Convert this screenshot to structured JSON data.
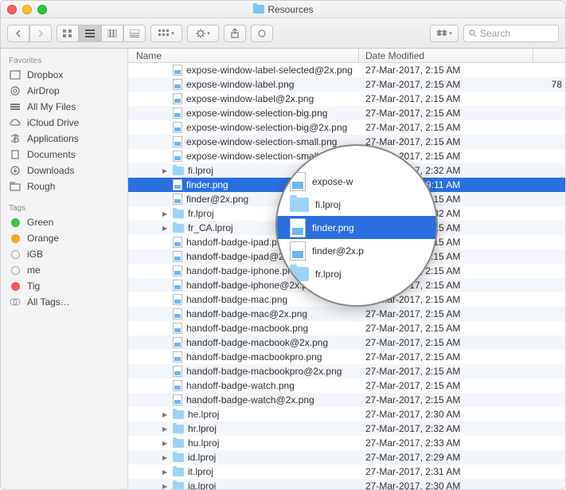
{
  "window": {
    "title": "Resources"
  },
  "toolbar": {
    "search_placeholder": "Search"
  },
  "columns": {
    "name": "Name",
    "date": "Date Modified"
  },
  "sidebar": {
    "favorites_label": "Favorites",
    "tags_label": "Tags",
    "favorites": [
      {
        "label": "Dropbox",
        "icon": "dropbox"
      },
      {
        "label": "AirDrop",
        "icon": "airdrop"
      },
      {
        "label": "All My Files",
        "icon": "allfiles"
      },
      {
        "label": "iCloud Drive",
        "icon": "icloud"
      },
      {
        "label": "Applications",
        "icon": "apps"
      },
      {
        "label": "Documents",
        "icon": "docs"
      },
      {
        "label": "Downloads",
        "icon": "downloads"
      },
      {
        "label": "Rough",
        "icon": "folder"
      }
    ],
    "tags": [
      {
        "label": "Green",
        "color": "#34c749"
      },
      {
        "label": "Orange",
        "color": "#f6a623"
      },
      {
        "label": "iGB",
        "color": "transparent"
      },
      {
        "label": "me",
        "color": "transparent"
      },
      {
        "label": "Tig",
        "color": "#fc5753"
      },
      {
        "label": "All Tags…",
        "color": null
      }
    ]
  },
  "files": [
    {
      "name": "expose-window-label-selected@2x.png",
      "date": "27-Mar-2017, 2:15 AM",
      "type": "png",
      "size": ""
    },
    {
      "name": "expose-window-label.png",
      "date": "27-Mar-2017, 2:15 AM",
      "type": "png",
      "size": "78"
    },
    {
      "name": "expose-window-label@2x.png",
      "date": "27-Mar-2017, 2:15 AM",
      "type": "png",
      "size": ""
    },
    {
      "name": "expose-window-selection-big.png",
      "date": "27-Mar-2017, 2:15 AM",
      "type": "png",
      "size": ""
    },
    {
      "name": "expose-window-selection-big@2x.png",
      "date": "27-Mar-2017, 2:15 AM",
      "type": "png",
      "size": ""
    },
    {
      "name": "expose-window-selection-small.png",
      "date": "27-Mar-2017, 2:15 AM",
      "type": "png",
      "size": ""
    },
    {
      "name": "expose-window-selection-small@2x.png",
      "date": "27-Mar-2017, 2:15 AM",
      "type": "png",
      "size": ""
    },
    {
      "name": "fi.lproj",
      "date": "27-Mar-2017, 2:32 AM",
      "type": "folder",
      "disc": true,
      "size": ""
    },
    {
      "name": "finder.png",
      "date": "25-Sep-2019, 9:11 AM",
      "type": "png",
      "selected": true,
      "size": ""
    },
    {
      "name": "finder@2x.png",
      "date": "27-Mar-2017, 2:15 AM",
      "type": "png",
      "size": ""
    },
    {
      "name": "fr.lproj",
      "date": "27-Mar-2017, 2:32 AM",
      "type": "folder",
      "disc": true,
      "size": ""
    },
    {
      "name": "fr_CA.lproj",
      "date": "27-Mar-2017, 2:15 AM",
      "type": "folder",
      "disc": true,
      "size": ""
    },
    {
      "name": "handoff-badge-ipad.png",
      "date": "27-Mar-2017, 2:15 AM",
      "type": "png",
      "size": ""
    },
    {
      "name": "handoff-badge-ipad@2x.png",
      "date": "27-Mar-2017, 2:15 AM",
      "type": "png",
      "size": ""
    },
    {
      "name": "handoff-badge-iphone.png",
      "date": "27-Mar-2017, 2:15 AM",
      "type": "png",
      "size": ""
    },
    {
      "name": "handoff-badge-iphone@2x.png",
      "date": "27-Mar-2017, 2:15 AM",
      "type": "png",
      "size": ""
    },
    {
      "name": "handoff-badge-mac.png",
      "date": "27-Mar-2017, 2:15 AM",
      "type": "png",
      "size": ""
    },
    {
      "name": "handoff-badge-mac@2x.png",
      "date": "27-Mar-2017, 2:15 AM",
      "type": "png",
      "size": ""
    },
    {
      "name": "handoff-badge-macbook.png",
      "date": "27-Mar-2017, 2:15 AM",
      "type": "png",
      "size": ""
    },
    {
      "name": "handoff-badge-macbook@2x.png",
      "date": "27-Mar-2017, 2:15 AM",
      "type": "png",
      "size": ""
    },
    {
      "name": "handoff-badge-macbookpro.png",
      "date": "27-Mar-2017, 2:15 AM",
      "type": "png",
      "size": ""
    },
    {
      "name": "handoff-badge-macbookpro@2x.png",
      "date": "27-Mar-2017, 2:15 AM",
      "type": "png",
      "size": ""
    },
    {
      "name": "handoff-badge-watch.png",
      "date": "27-Mar-2017, 2:15 AM",
      "type": "png",
      "size": ""
    },
    {
      "name": "handoff-badge-watch@2x.png",
      "date": "27-Mar-2017, 2:15 AM",
      "type": "png",
      "size": ""
    },
    {
      "name": "he.lproj",
      "date": "27-Mar-2017, 2:30 AM",
      "type": "folder",
      "disc": true,
      "size": ""
    },
    {
      "name": "hr.lproj",
      "date": "27-Mar-2017, 2:32 AM",
      "type": "folder",
      "disc": true,
      "size": ""
    },
    {
      "name": "hu.lproj",
      "date": "27-Mar-2017, 2:33 AM",
      "type": "folder",
      "disc": true,
      "size": ""
    },
    {
      "name": "id.lproj",
      "date": "27-Mar-2017, 2:29 AM",
      "type": "folder",
      "disc": true,
      "size": ""
    },
    {
      "name": "it.lproj",
      "date": "27-Mar-2017, 2:31 AM",
      "type": "folder",
      "disc": true,
      "size": ""
    },
    {
      "name": "ja.lproj",
      "date": "27-Mar-2017, 2:30 AM",
      "type": "folder",
      "disc": true,
      "size": ""
    }
  ],
  "magnifier": [
    {
      "label": "expose-w",
      "type": "png"
    },
    {
      "label": "fi.lproj",
      "type": "folder"
    },
    {
      "label": "finder.png",
      "type": "png",
      "selected": true
    },
    {
      "label": "finder@2x.p",
      "type": "png"
    },
    {
      "label": "fr.lproj",
      "type": "folder"
    }
  ]
}
